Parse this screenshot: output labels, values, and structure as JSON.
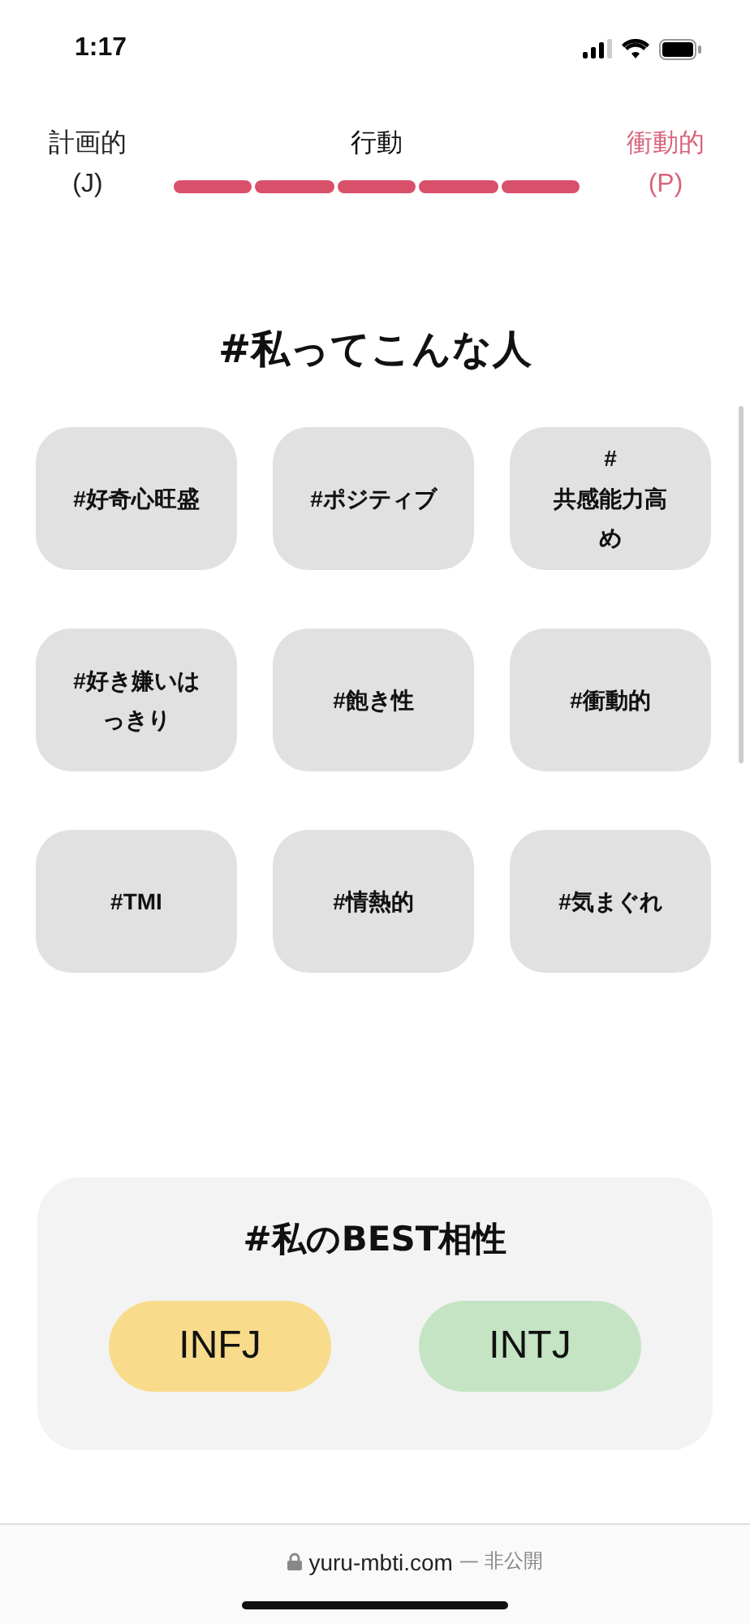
{
  "status_bar": {
    "time": "1:17"
  },
  "meter": {
    "left": {
      "label": "計画的",
      "letter": "(J)",
      "selected": false
    },
    "title": "行動",
    "segments": [
      {
        "filled": true
      },
      {
        "filled": true
      },
      {
        "filled": true
      },
      {
        "filled": true
      },
      {
        "filled": true
      }
    ],
    "right": {
      "label": "衝動的",
      "letter": "(P)",
      "selected": true
    }
  },
  "traits": {
    "title": "#私ってこんな人",
    "tags": [
      {
        "label": "#好奇心旺盛"
      },
      {
        "label": "#ポジティブ"
      },
      {
        "label": "#共感能力高め"
      },
      {
        "label": "#好き嫌いはっきり"
      },
      {
        "label": "#飽き性"
      },
      {
        "label": "#衝動的"
      },
      {
        "label": "#TMI"
      },
      {
        "label": "#情熱的"
      },
      {
        "label": "#気まぐれ"
      }
    ]
  },
  "best_match": {
    "title": "#私のBEST相性",
    "types": [
      {
        "label": "INFJ",
        "color": "#f8dc8c"
      },
      {
        "label": "INTJ",
        "color": "#c4e4c4"
      }
    ]
  },
  "address_bar": {
    "domain": "yuru-mbti.com",
    "note": "— 非公開"
  }
}
